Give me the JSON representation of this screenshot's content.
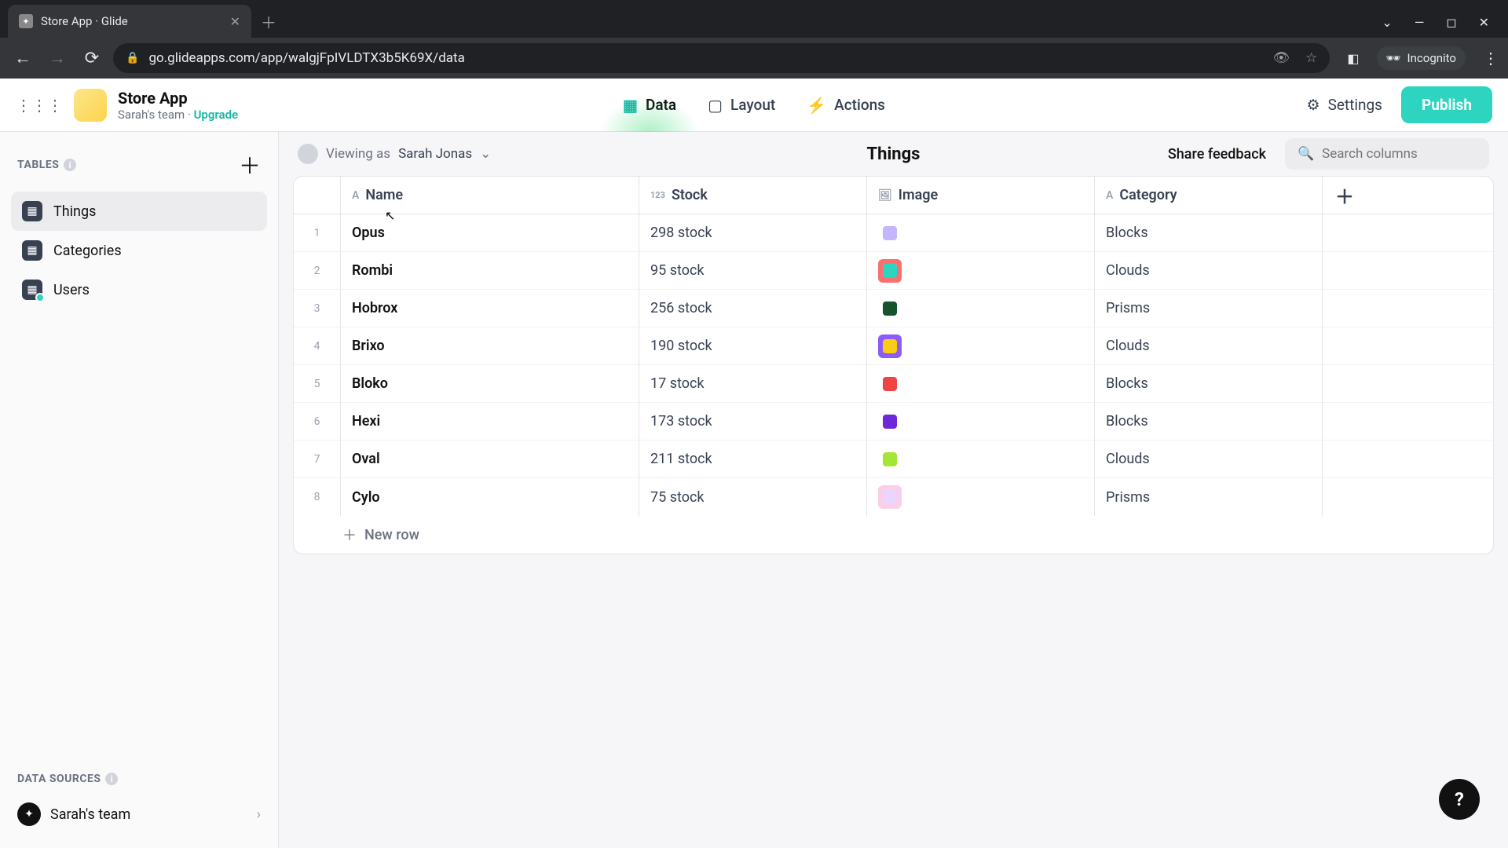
{
  "browser": {
    "tab_title": "Store App · Glide",
    "url": "go.glideapps.com/app/walgjFpIVLDTX3b5K69X/data",
    "incognito_label": "Incognito"
  },
  "app": {
    "name": "Store App",
    "team_label": "Sarah's team",
    "upgrade_label": "Upgrade",
    "tabs": {
      "data": "Data",
      "layout": "Layout",
      "actions": "Actions"
    },
    "settings_label": "Settings",
    "publish_label": "Publish"
  },
  "sidebar": {
    "tables_header": "TABLES",
    "tables": [
      {
        "label": "Things",
        "active": true
      },
      {
        "label": "Categories",
        "active": false
      },
      {
        "label": "Users",
        "active": false
      }
    ],
    "data_sources_header": "DATA SOURCES",
    "data_source": "Sarah's team"
  },
  "toolbar": {
    "viewing_as_prefix": "Viewing as",
    "viewing_as_name": "Sarah Jonas",
    "table_title": "Things",
    "share_feedback": "Share feedback",
    "search_placeholder": "Search columns"
  },
  "columns": [
    {
      "label": "Name",
      "type": "text"
    },
    {
      "label": "Stock",
      "type": "number"
    },
    {
      "label": "Image",
      "type": "image"
    },
    {
      "label": "Category",
      "type": "text"
    }
  ],
  "rows": [
    {
      "n": "1",
      "name": "Opus",
      "stock": "298 stock",
      "category": "Blocks",
      "thumb": "#c4b5fd"
    },
    {
      "n": "2",
      "name": "Rombi",
      "stock": "95 stock",
      "category": "Clouds",
      "thumb": "#2dd4bf",
      "thumb_bg": "#f87171"
    },
    {
      "n": "3",
      "name": "Hobrox",
      "stock": "256 stock",
      "category": "Prisms",
      "thumb": "#14532d"
    },
    {
      "n": "4",
      "name": "Brixo",
      "stock": "190 stock",
      "category": "Clouds",
      "thumb": "#facc15",
      "thumb_bg": "#8b5cf6"
    },
    {
      "n": "5",
      "name": "Bloko",
      "stock": "17 stock",
      "category": "Blocks",
      "thumb": "#ef4444"
    },
    {
      "n": "6",
      "name": "Hexi",
      "stock": "173 stock",
      "category": "Blocks",
      "thumb": "#6d28d9"
    },
    {
      "n": "7",
      "name": "Oval",
      "stock": "211 stock",
      "category": "Clouds",
      "thumb": "#a3e635"
    },
    {
      "n": "8",
      "name": "Cylo",
      "stock": "75 stock",
      "category": "Prisms",
      "thumb": "#e9d5ff",
      "thumb_bg": "#fbcfe8"
    }
  ],
  "new_row_label": "New row"
}
